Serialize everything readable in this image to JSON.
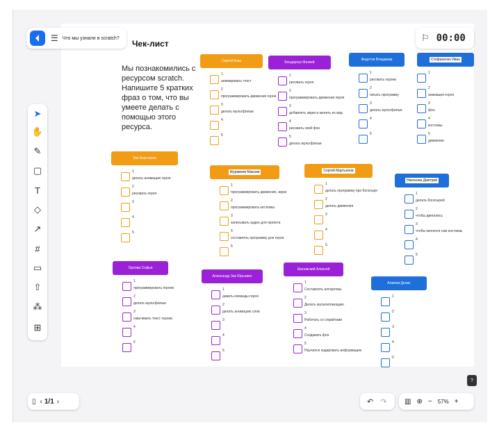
{
  "board_title": "Что мы узнали в scratch?",
  "menu_icon": "hamburger-icon",
  "timer": "00:00",
  "heading": "Чек-лист",
  "intro": "Мы познакомились с ресурсом scratch. Напишите 5 кратких фраз о том, что вы умеете делать с помощью этого ресурса.",
  "tools": [
    "cursor-icon",
    "hand-icon",
    "pen-icon",
    "sticky-note-icon",
    "text-icon",
    "shapes-icon",
    "arrow-icon",
    "frame-icon",
    "comment-icon",
    "upload-icon",
    "templates-icon",
    "plus-icon"
  ],
  "pages": "1/1",
  "zoom": "57%",
  "help": "?",
  "colors": {
    "orange": "#f29b14",
    "purple": "#9b21d6",
    "blue": "#1e6fd9"
  },
  "cards": [
    {
      "name": "Сергей Баш",
      "color": "orange",
      "items": [
        "анимировать текст",
        "программировать движения героя",
        "делать мультфильм",
        "",
        ""
      ]
    },
    {
      "name": "Бондарчук Матвей",
      "color": "purple",
      "items": [
        "рисовать героя",
        "программировать движения героя",
        "добавлять звуки и менять их вид",
        "рисовать свой фон",
        "делать мультфильм"
      ]
    },
    {
      "name": "Федотов Владимир",
      "color": "blue",
      "items": [
        "рисовать героев",
        "писать программу",
        "делать мультфильм",
        "",
        ""
      ]
    },
    {
      "name": "Стефаненко Иван",
      "color": "blue",
      "items": [
        "",
        "анимация героя",
        "фон",
        "костюмы",
        "движение"
      ]
    },
    {
      "name": "Зак Анастасия",
      "color": "orange",
      "items": [
        "делать анимацию героя",
        "рисовать героя",
        "",
        "",
        ""
      ]
    },
    {
      "name": "Журавлев Максим",
      "color": "orange",
      "items": [
        "программировать движения, звуки",
        "программировать костюмы",
        "записывать аудио для проекта",
        "составлять программу для героя",
        ""
      ]
    },
    {
      "name": "Сергей Мартьянов",
      "color": "orange",
      "items": [
        "делать программу про богатыря",
        "делать движения",
        "",
        "",
        ""
      ]
    },
    {
      "name": "Никонова Дмитрий",
      "color": "blue",
      "items": [
        "делать богатырей",
        "чтобы двигались",
        "чтобы менялся сам костюмы",
        "",
        ""
      ]
    },
    {
      "name": "Орлова Софья",
      "color": "purple",
      "items": [
        "программировать героев",
        "делать мультфильм",
        "озвучивать текст героев",
        "",
        ""
      ]
    },
    {
      "name": "Александр Зак Юрьевич",
      "color": "purple",
      "items": [
        "давать команды героя",
        "делать анимацию слов",
        "",
        "",
        ""
      ]
    },
    {
      "name": "Шаповский Алексей",
      "color": "purple",
      "items": [
        "Составлять алгоритмы",
        "Делать мультипликацию",
        "Работать со спрайтами",
        "Создавать фон",
        "Научился кодировать информацию"
      ]
    },
    {
      "name": "Алимов Денис",
      "color": "blue",
      "items": [
        "",
        "",
        "",
        "",
        ""
      ]
    }
  ]
}
